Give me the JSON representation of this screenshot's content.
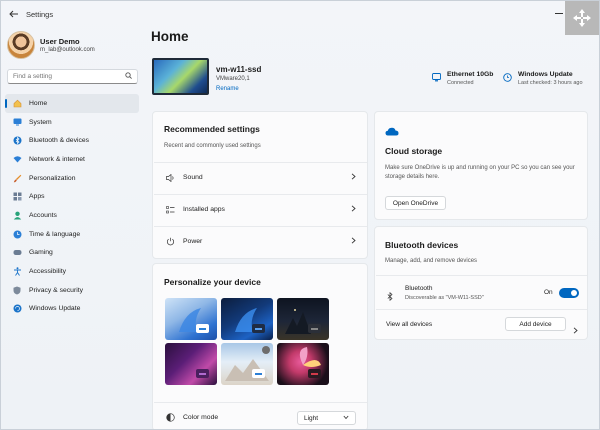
{
  "window": {
    "title": "Settings"
  },
  "profile": {
    "name": "User Demo",
    "email": "m_lab@outlook.com"
  },
  "search": {
    "placeholder": "Find a setting"
  },
  "nav": [
    {
      "label": "Home",
      "icon": "home-icon",
      "active": true
    },
    {
      "label": "System",
      "icon": "system-icon"
    },
    {
      "label": "Bluetooth & devices",
      "icon": "bluetooth-icon"
    },
    {
      "label": "Network & internet",
      "icon": "wifi-icon"
    },
    {
      "label": "Personalization",
      "icon": "brush-icon"
    },
    {
      "label": "Apps",
      "icon": "apps-icon"
    },
    {
      "label": "Accounts",
      "icon": "accounts-icon"
    },
    {
      "label": "Time & language",
      "icon": "globe-clock-icon"
    },
    {
      "label": "Gaming",
      "icon": "gamepad-icon"
    },
    {
      "label": "Accessibility",
      "icon": "accessibility-icon"
    },
    {
      "label": "Privacy & security",
      "icon": "shield-icon"
    },
    {
      "label": "Windows Update",
      "icon": "update-icon"
    }
  ],
  "main": {
    "title": "Home",
    "device": {
      "name": "vm-w11-ssd",
      "model": "VMware20,1",
      "rename": "Rename"
    },
    "status": [
      {
        "title": "Ethernet 10Gb",
        "sub": "Connected",
        "icon": "monitor-network-icon"
      },
      {
        "title": "Windows Update",
        "sub": "Last checked: 3 hours ago",
        "icon": "update-icon"
      }
    ]
  },
  "recommended": {
    "title": "Recommended settings",
    "subtitle": "Recent and commonly used settings",
    "items": [
      {
        "label": "Sound",
        "icon": "speaker-icon"
      },
      {
        "label": "Installed apps",
        "icon": "list-icon"
      },
      {
        "label": "Power",
        "icon": "power-icon"
      }
    ]
  },
  "personalize": {
    "title": "Personalize your device",
    "color_mode_label": "Color mode",
    "color_mode_value": "Light"
  },
  "cloud": {
    "title": "Cloud storage",
    "desc": "Make sure OneDrive is up and running on your PC so you can see your storage details here.",
    "button": "Open OneDrive"
  },
  "bluetooth": {
    "title": "Bluetooth devices",
    "subtitle": "Manage, add, and remove devices",
    "device_title": "Bluetooth",
    "device_sub": "Discoverable as \"VM-W11-SSD\"",
    "toggle_state": "On",
    "view_all": "View all devices",
    "add_button": "Add device"
  },
  "colors": {
    "accent": "#0067c0",
    "background": "#f3f5f9",
    "card": "#fbfbfc"
  }
}
